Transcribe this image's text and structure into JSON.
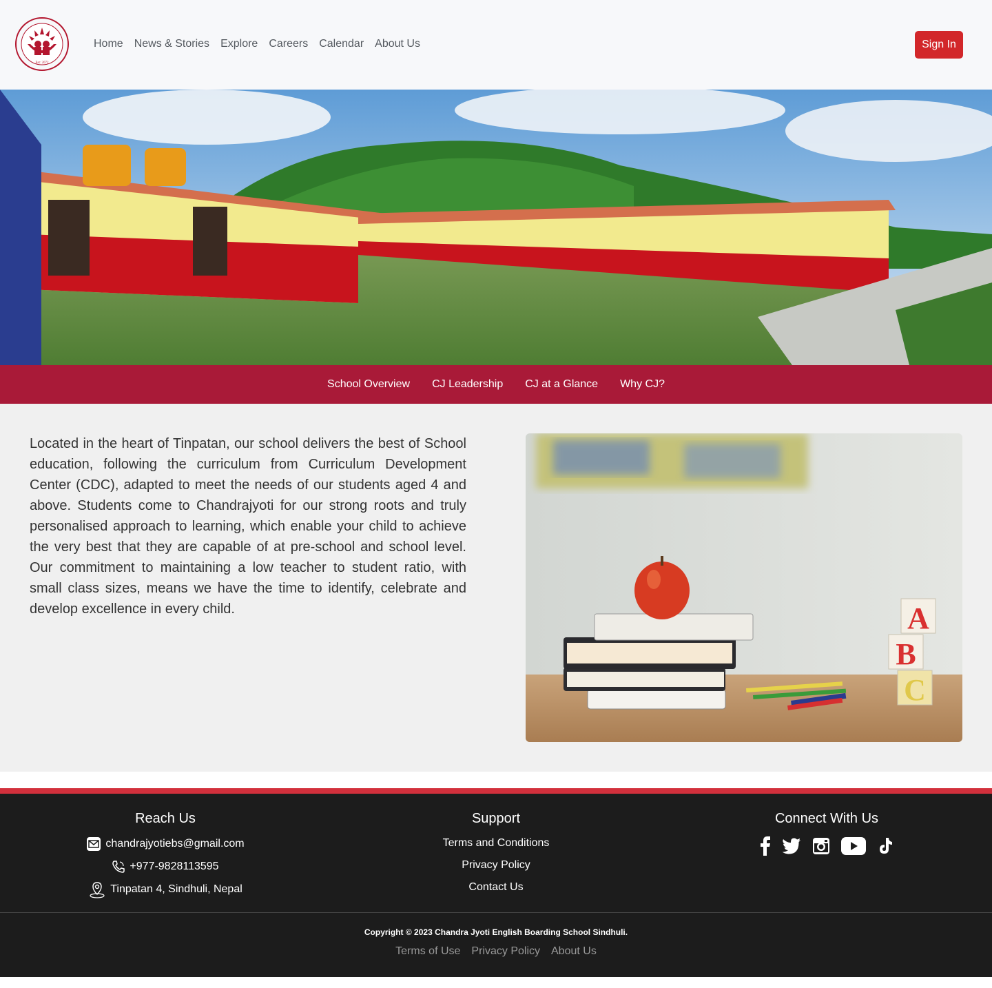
{
  "header": {
    "logo_alt": "Chandrajyoti English Boarding School logo",
    "logo_ring_text": "Chandrajyoti English Boarding School",
    "logo_est": "Est: 2072",
    "logo_location": "Tinpatan 4, Sindhuli, Nepal",
    "nav": [
      "Home",
      "News & Stories",
      "Explore",
      "Careers",
      "Calendar",
      "About Us"
    ],
    "sign_in": "Sign In"
  },
  "subnav": [
    "School Overview",
    "CJ Leadership",
    "CJ at a Glance",
    "Why CJ?"
  ],
  "overview": {
    "text": "Located in the heart of Tinpatan, our school delivers the best of School education, following the curriculum from Curriculum Development Center (CDC), adapted to meet the needs of our students aged 4 and above. Students come to Chandrajyoti for our strong roots and truly personalised approach to learning, which enable your child to achieve the very best that they are capable of at pre-school and school level. Our commitment to maintaining a low teacher to student ratio, with small class sizes, means we have the time to identify, celebrate and develop excellence in every child.",
    "image_letters": [
      "A",
      "B",
      "C"
    ]
  },
  "footer": {
    "reach_us": {
      "title": "Reach Us",
      "email": "chandrajyotiebs@gmail.com",
      "phone": "+977-9828113595",
      "address": "Tinpatan 4, Sindhuli, Nepal"
    },
    "support": {
      "title": "Support",
      "links": [
        "Terms and Conditions",
        "Privacy Policy",
        "Contact Us"
      ]
    },
    "connect": {
      "title": "Connect With Us",
      "icons": [
        "facebook-icon",
        "twitter-icon",
        "instagram-icon",
        "youtube-icon",
        "tiktok-icon"
      ]
    },
    "copyright": "Copyright © 2023 Chandra Jyoti English Boarding School Sindhuli.",
    "bottom_links": [
      "Terms of Use",
      "Privacy Policy",
      "About Us"
    ]
  },
  "colors": {
    "brand_red": "#a91a38",
    "button_red": "#d2272a",
    "footer_bg": "#1c1c1c"
  }
}
